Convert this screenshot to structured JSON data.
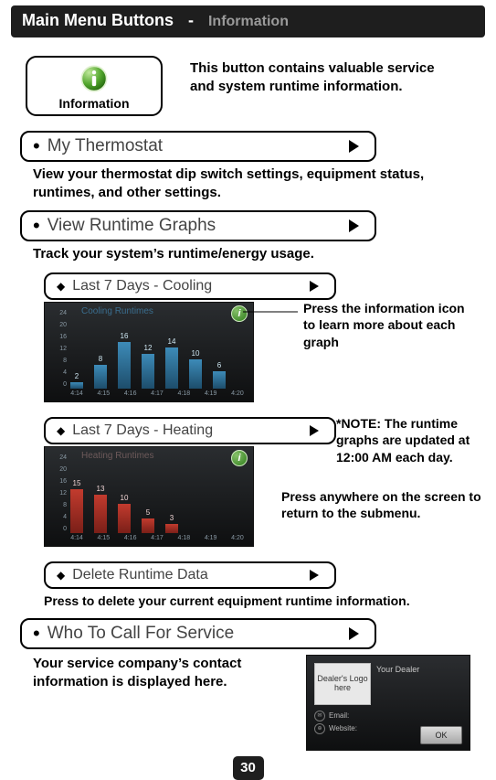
{
  "header": {
    "title_main": "Main Menu Buttons",
    "sep": "-",
    "title_sub": "Information"
  },
  "intro": {
    "btn_label": "Information",
    "desc": "This button contains valuable service and system runtime information."
  },
  "options": {
    "my_thermostat": {
      "label": "My Thermostat",
      "desc": "View your thermostat dip switch settings, equipment status, runtimes, and other settings."
    },
    "view_runtime": {
      "label": "View Runtime Graphs",
      "desc": "Track your system’s runtime/energy usage."
    },
    "who_to_call": {
      "label": "Who To Call For Service",
      "desc": "Your service company’s contact information is displayed here."
    }
  },
  "subs": {
    "cooling": {
      "label": "Last 7 Days - Cooling"
    },
    "heating": {
      "label": "Last 7 Days - Heating"
    },
    "delete": {
      "label": "Delete Runtime Data",
      "desc": "Press to delete your current equipment runtime information."
    }
  },
  "side": {
    "press_info": "Press the information icon to learn more about each graph",
    "note": "*NOTE: The runtime graphs are updated at 12:00 AM each day.",
    "press_anywhere": "Press anywhere on the screen to return to the submenu."
  },
  "dealer": {
    "logo_text": "Dealer's Logo here",
    "header": "Your Dealer",
    "email": "Email:",
    "website": "Website:",
    "ok": "OK"
  },
  "pagenum": "30",
  "chart_data": [
    {
      "type": "bar",
      "name": "Cooling Runtimes",
      "categories": [
        "4:14",
        "4:15",
        "4:16",
        "4:17",
        "4:18",
        "4:19",
        "4:20"
      ],
      "values": [
        2,
        8,
        16,
        12,
        14,
        10,
        6
      ],
      "ylim": [
        0,
        24
      ],
      "yticks": [
        24,
        20,
        16,
        12,
        8,
        4,
        0
      ],
      "title": "Cooling Runtimes"
    },
    {
      "type": "bar",
      "name": "Heating Runtimes",
      "categories": [
        "4:14",
        "4:15",
        "4:16",
        "4:17",
        "4:18",
        "4:19",
        "4:20"
      ],
      "values": [
        15,
        13,
        10,
        5,
        3,
        0,
        0
      ],
      "ylim": [
        0,
        24
      ],
      "yticks": [
        24,
        20,
        16,
        12,
        8,
        4,
        0
      ],
      "title": "Heating Runtimes"
    }
  ]
}
